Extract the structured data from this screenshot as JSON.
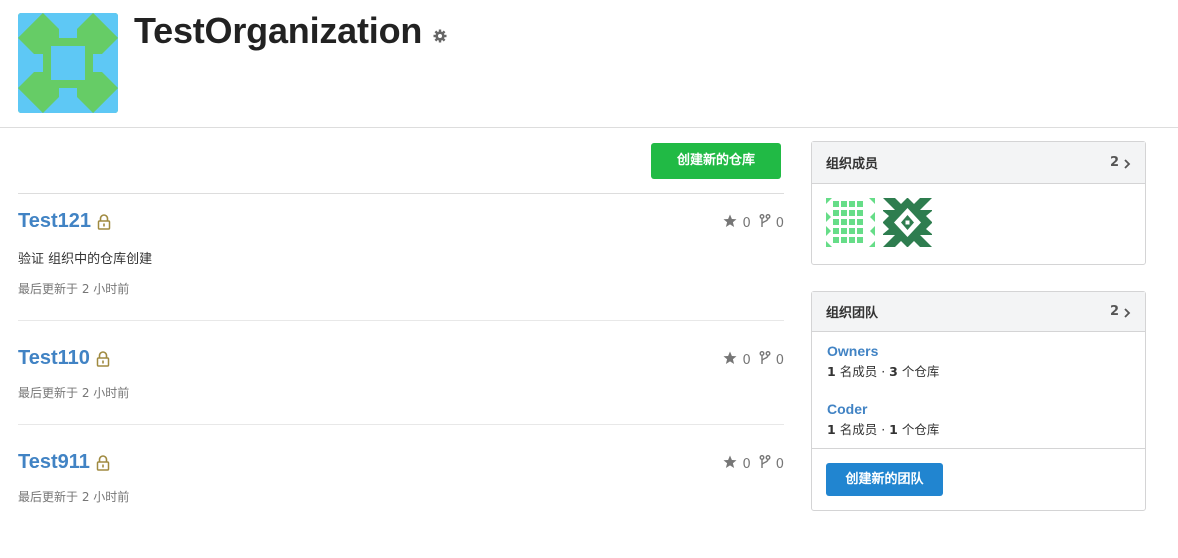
{
  "organization": {
    "name": "TestOrganization",
    "avatar_icon": "identicon-avatar",
    "settings_icon": "gear-icon"
  },
  "repos": {
    "new_button_label": "创建新的仓库",
    "items": [
      {
        "name": "Test121",
        "private": true,
        "stars": "0",
        "forks": "0",
        "description": "验证 组织中的仓库创建",
        "updated": "最后更新于 2 小时前"
      },
      {
        "name": "Test110",
        "private": true,
        "stars": "0",
        "forks": "0",
        "description": "",
        "updated": "最后更新于 2 小时前"
      },
      {
        "name": "Test911",
        "private": true,
        "stars": "0",
        "forks": "0",
        "description": "",
        "updated": "最后更新于 2 小时前"
      }
    ]
  },
  "members": {
    "title": "组织成员",
    "count": "2"
  },
  "teams": {
    "title": "组织团队",
    "count": "2",
    "items": [
      {
        "name": "Owners",
        "members_count": "1",
        "members_label": "名成员",
        "separator": "·",
        "repos_count": "3",
        "repos_label": "个仓库"
      },
      {
        "name": "Coder",
        "members_count": "1",
        "members_label": "名成员",
        "separator": "·",
        "repos_count": "1",
        "repos_label": "个仓库"
      }
    ],
    "new_button_label": "创建新的团队"
  },
  "colors": {
    "green_button": "#21ba45",
    "blue_button": "#2185d0",
    "link": "#4183c4",
    "avatar_green": "#66cc66",
    "avatar_blue": "#5ec8f5",
    "member1": "#66dd88",
    "member2": "#2e7d4f"
  }
}
